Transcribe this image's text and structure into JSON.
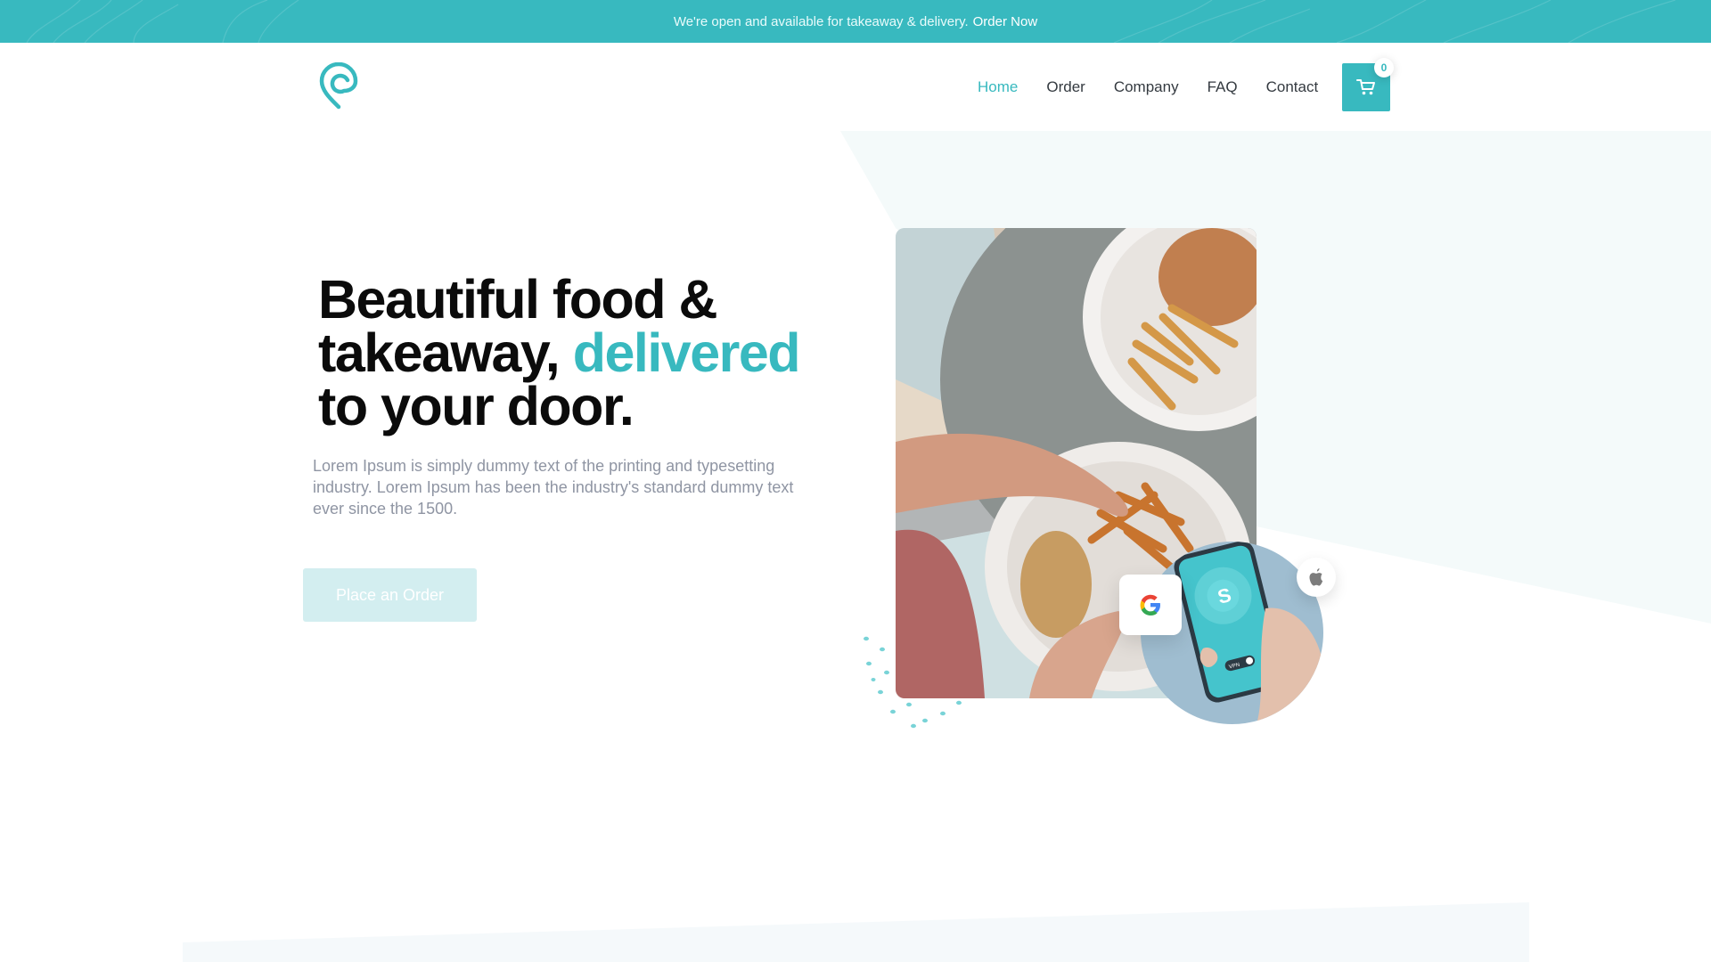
{
  "banner": {
    "message": "We're open and available for takeaway & delivery.",
    "link": "Order Now"
  },
  "nav": {
    "items": [
      {
        "label": "Home",
        "active": true
      },
      {
        "label": "Order",
        "active": false
      },
      {
        "label": "Company",
        "active": false
      },
      {
        "label": "FAQ",
        "active": false
      },
      {
        "label": "Contact",
        "active": false
      }
    ]
  },
  "cart": {
    "count": "0",
    "icon": "cart-icon"
  },
  "hero": {
    "line1": "Beautiful food &",
    "line2_pre": "takeaway,",
    "line2_accent": "delivered",
    "line3": "to your door.",
    "lead": "Lorem Ipsum is simply dummy text of the printing and typesetting industry. Lorem Ipsum has been the industry's standard dummy text ever since the 1500.",
    "cta": "Place an Order"
  },
  "phone": {
    "app_toggle": "VPN"
  },
  "colors": {
    "accent": "#38b9bf",
    "text_dark": "#0b0b0b",
    "text_muted": "#8f95a3",
    "cta_bg": "#d3eef0",
    "panel_bg": "#f5fbfb"
  }
}
